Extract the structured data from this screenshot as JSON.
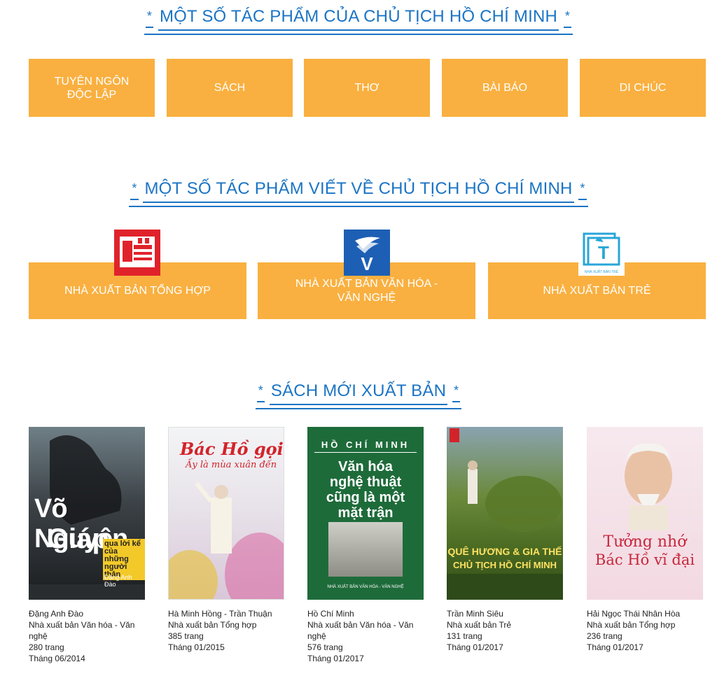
{
  "section1": {
    "title": "MỘT SỐ TÁC PHẨM CỦA CHỦ TỊCH HỒ CHÍ MINH",
    "categories": [
      {
        "label": "TUYÊN NGÔN ĐỘC LẬP"
      },
      {
        "label": "SÁCH"
      },
      {
        "label": "THƠ"
      },
      {
        "label": "BÀI BÁO"
      },
      {
        "label": "DI CHÚC"
      }
    ]
  },
  "section2": {
    "title": "MỘT SỐ TÁC PHẨM VIẾT VỀ CHỦ TỊCH HỒ CHÍ MINH",
    "publishers": [
      {
        "label": "NHÀ XUẤT BẢN TỔNG HỢP",
        "logo": "tong-hop-logo"
      },
      {
        "label": "NHÀ XUẤT BẢN VĂN HÓA - VĂN NGHỆ",
        "logo": "van-hoa-van-nghe-logo"
      },
      {
        "label": "NHÀ XUẤT BẢN TRẺ",
        "logo": "tre-logo"
      }
    ]
  },
  "section3": {
    "title": "SÁCH MỚI XUẤT BẢN",
    "books": [
      {
        "author": "Đặng Anh Đào",
        "publisher": "Nhà xuất bản Văn hóa - Văn nghệ",
        "pages": "280 trang",
        "date": "Tháng 06/2014",
        "cover": {
          "title1": "Võ Nguyên",
          "title2": "Giáp",
          "subtitle": "qua lời kể của những người thân",
          "author": "Đặng Anh Đào"
        }
      },
      {
        "author": "Hà Minh Hồng - Trần Thuận",
        "publisher": "Nhà xuất bản Tổng hợp",
        "pages": "385 trang",
        "date": "Tháng 01/2015",
        "cover": {
          "title1": "Bác Hồ gọi",
          "title2": "Ấy là mùa xuân đến"
        }
      },
      {
        "author": "Hồ Chí Minh",
        "publisher": "Nhà xuất bản Văn hóa - Văn nghệ",
        "pages": "576 trang",
        "date": "Tháng 01/2017",
        "cover": {
          "top": "HỒ CHÍ MINH",
          "title": "Văn hóa nghệ thuật cũng là một mặt trận",
          "bottom": "NHÀ XUẤT BẢN VĂN HÓA - VĂN NGHỆ"
        }
      },
      {
        "author": "Trần Minh Siêu",
        "publisher": "Nhà xuất bản Trẻ",
        "pages": "131 trang",
        "date": "Tháng 01/2017",
        "cover": {
          "title1": "QUÊ HƯƠNG & GIA THẾ",
          "title2": "CHỦ TỊCH HỒ CHÍ MINH"
        }
      },
      {
        "author": "Hải Ngọc Thái Nhân Hòa",
        "publisher": "Nhà xuất bản Tổng hợp",
        "pages": "236 trang",
        "date": "Tháng 01/2017",
        "cover": {
          "title1": "Tưởng nhớ",
          "title2": "Bác Hồ vĩ đại"
        }
      }
    ]
  },
  "colors": {
    "accent": "#1b74c4",
    "tile": "#f9b040"
  }
}
